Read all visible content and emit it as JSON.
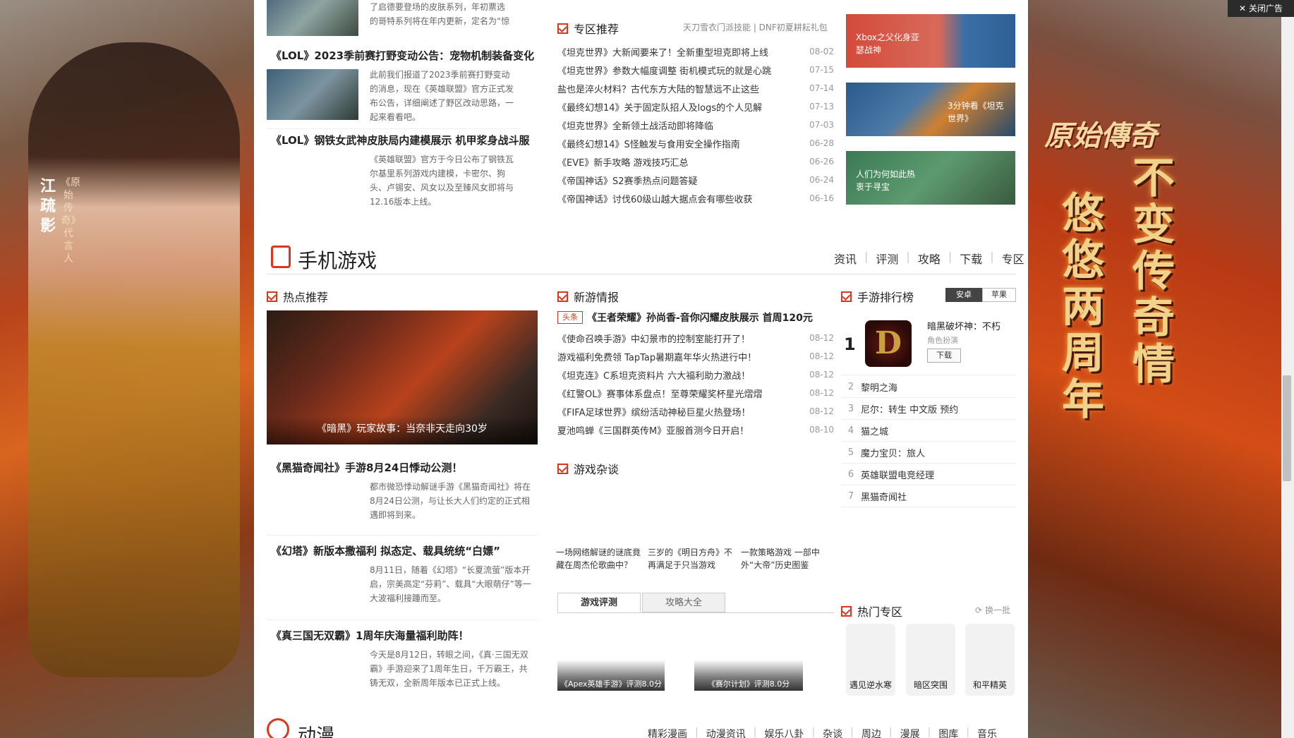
{
  "close_ad": "关闭广告",
  "left_ad": {
    "name": "江疏影",
    "sub": "《原始传奇》代言人"
  },
  "right_ad": {
    "logo": "原始傳奇",
    "slogan_a": "不变传奇情",
    "slogan_b": "悠悠两周年"
  },
  "top_item": {
    "desc": "了启德要登场的皮肤系列，年初票选的哥特系列将在年内更新，定名为“惊魂之夜（Fright"
  },
  "news": [
    {
      "title": "《LOL》2023季前赛打野变动公告：宠物机制装备变化",
      "desc": "此前我们报道了2023季前赛打野变动的消息，现在《英雄联盟》官方正式发布公告，详细阐述了野区改动思路，一起来看看吧。"
    },
    {
      "title": "《LOL》钢铁女武神皮肤局内建模展示 机甲浆身战斗服",
      "desc": "《英雄联盟》官方于今日公布了钢铁瓦尔基里系列游戏内建模，卡密尔、狗头、卢锡安、风女以及至臻风女即将与12.16版本上线。"
    }
  ],
  "zone_rec": {
    "title": "专区推荐",
    "links": "天刀雪衣门派技能 | DNF初夏耕耘礼包",
    "items": [
      {
        "t": "《坦克世界》大新闻要来了！全新重型坦克即将上线",
        "d": "08-02"
      },
      {
        "t": "《坦克世界》参数大幅度调整 街机模式玩的就是心跳",
        "d": "07-15"
      },
      {
        "t": "盐也是淬火材料？古代东方大陆的智慧远不止这些",
        "d": "07-14"
      },
      {
        "t": "《最终幻想14》关于固定队招人及logs的个人见解",
        "d": "07-13"
      },
      {
        "t": "《坦克世界》全新领土战活动即将降临",
        "d": "07-03"
      },
      {
        "t": "《最终幻想14》S怪触发与食用安全操作指南",
        "d": "06-28"
      },
      {
        "t": "《EVE》新手攻略 游戏技巧汇总",
        "d": "06-26"
      },
      {
        "t": "《帝国神话》S2赛季热点问题答疑",
        "d": "06-24"
      },
      {
        "t": "《帝国神话》讨伐60级山越大据点会有哪些收获",
        "d": "06-16"
      }
    ]
  },
  "side_cards": [
    {
      "text": "Xbox之父化身亚瑟战神"
    },
    {
      "text": "3分钟看《坦克世界》"
    },
    {
      "text": "人们为何如此热衷于寻宝"
    }
  ],
  "mobile": {
    "title": "手机游戏",
    "nav": [
      "资讯",
      "评测",
      "攻略",
      "下载",
      "专区"
    ],
    "hot_title": "热点推荐",
    "hot_caption": "《暗黑》玩家故事：当奈非天走向30岁",
    "hot_news": [
      {
        "title": "《黑猫奇闻社》手游8月24日悸动公测！",
        "desc": "都市微恐悸动解谜手游《黑猫奇闻社》将在8月24日公测，与让长大人们约定的正式相遇即将到来。"
      },
      {
        "title": "《幻塔》新版本撒福利 拟态定、载具统统“白嫖”",
        "desc": "8月11日，随着《幻塔》“长夏流萤”版本开启，宗美高定“芬莉”、载具“大眼萌仔”等一大波福利接踵而至。"
      },
      {
        "title": "《真三国无双霸》1周年庆海量福利助阵！",
        "desc": "今天是8月12日，转眼之间，《真·三国无双霸》手游迎来了1周年生日，千万霸王，共铸无双，全新周年版本已正式上线。"
      }
    ],
    "new_title": "新游情报",
    "headline_badge": "头条",
    "headline": "《王者荣耀》孙尚香-音你闪耀皮肤展示 首周120元",
    "new_items": [
      {
        "t": "《使命召唤手游》中幻景市的控制室能打开了！",
        "d": "08-12"
      },
      {
        "t": "游戏福利免费领 TapTap暑期嘉年华火热进行中！",
        "d": "08-12"
      },
      {
        "t": "《坦克连》C系坦克资料片 六大福利助力激战！",
        "d": "08-12"
      },
      {
        "t": "《红警OL》赛事体系盘点！至尊荣耀奖杯星光熠熠",
        "d": "08-12"
      },
      {
        "t": "《FIFA足球世界》缤纷活动神秘巨星火热登场！",
        "d": "08-12"
      },
      {
        "t": "夏池鸣蝉《三国群英传M》亚服首测今日开启！",
        "d": "08-10"
      }
    ],
    "misc_title": "游戏杂谈",
    "misc": [
      "一场网络解谜的谜底竟藏在周杰伦歌曲中？",
      "三岁的《明日方舟》不再满足于只当游戏",
      "一款策略游戏 一部中外“大帝”历史图鉴"
    ],
    "tabs": [
      "游戏评测",
      "攻略大全"
    ],
    "reviews": [
      "《Apex英雄手游》评测8.0分",
      "《赛尔计划》评测8.0分"
    ],
    "rank_title": "手游排行榜",
    "rank_tabs": [
      "安卓",
      "苹果"
    ],
    "rank_top": {
      "n": "1",
      "name": "暗黑破坏神：不朽",
      "genre": "角色扮演",
      "btn": "下载"
    },
    "rank_list": [
      {
        "n": "2",
        "name": "黎明之海"
      },
      {
        "n": "3",
        "name": "尼尔：转生 中文版 预约"
      },
      {
        "n": "4",
        "name": "猫之城"
      },
      {
        "n": "5",
        "name": "魔力宝贝：旅人"
      },
      {
        "n": "6",
        "name": "英雄联盟电竞经理"
      },
      {
        "n": "7",
        "name": "黑猫奇闻社"
      }
    ],
    "zones_title": "热门专区",
    "zones_refresh": "换一批",
    "zones": [
      "遇见逆水寒",
      "暗区突围",
      "和平精英"
    ]
  },
  "anime": {
    "title": "动漫",
    "nav": [
      "精彩漫画",
      "动漫资讯",
      "娱乐八卦",
      "杂谈",
      "周边",
      "漫展",
      "图库",
      "音乐"
    ]
  }
}
